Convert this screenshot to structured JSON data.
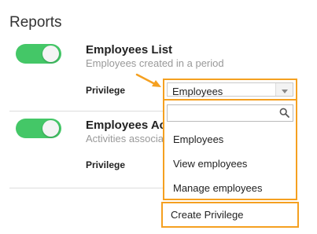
{
  "section": {
    "title": "Reports"
  },
  "reports": [
    {
      "title": "Employees List",
      "description": "Employees created in a period",
      "privilege_label": "Privilege",
      "enabled": true
    },
    {
      "title": "Employees Activities",
      "description": "Activities associated",
      "privilege_label": "Privilege",
      "enabled": true
    }
  ],
  "privilege_select": {
    "selected": "Employees",
    "search_placeholder": "",
    "options": [
      "Employees",
      "View employees",
      "Manage employees"
    ],
    "create_label": "Create Privilege"
  },
  "colors": {
    "toggle_on": "#44c767",
    "highlight": "#f5a020"
  },
  "icons": {
    "search": "search-icon",
    "dropdown": "chevron-down-icon",
    "annotation": "arrow-icon"
  }
}
